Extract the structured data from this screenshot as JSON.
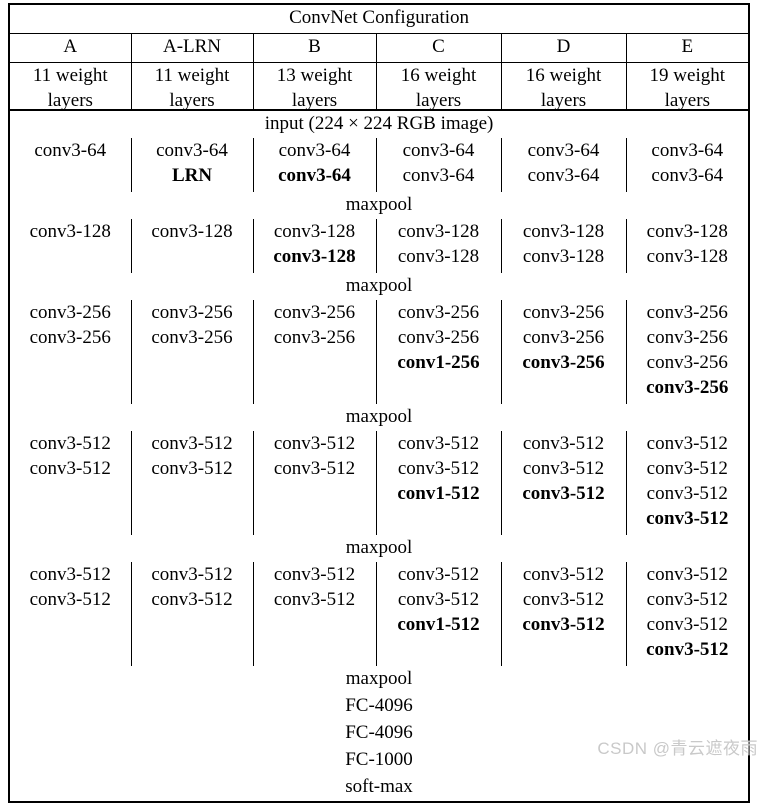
{
  "table": {
    "title": "ConvNet Configuration",
    "columns": [
      {
        "name": "A",
        "depth": "11 weight layers"
      },
      {
        "name": "A-LRN",
        "depth": "11 weight layers"
      },
      {
        "name": "B",
        "depth": "13 weight layers"
      },
      {
        "name": "C",
        "depth": "16 weight layers"
      },
      {
        "name": "D",
        "depth": "16 weight layers"
      },
      {
        "name": "E",
        "depth": "19 weight layers"
      }
    ],
    "input_row": "input (224 × 224 RGB image)",
    "pool_label": "maxpool",
    "blocks": [
      {
        "id": "block-64",
        "cells": [
          [
            {
              "text": "conv3-64",
              "bold": false
            }
          ],
          [
            {
              "text": "conv3-64",
              "bold": false
            },
            {
              "text": "LRN",
              "bold": true
            }
          ],
          [
            {
              "text": "conv3-64",
              "bold": false
            },
            {
              "text": "conv3-64",
              "bold": true
            }
          ],
          [
            {
              "text": "conv3-64",
              "bold": false
            },
            {
              "text": "conv3-64",
              "bold": false
            }
          ],
          [
            {
              "text": "conv3-64",
              "bold": false
            },
            {
              "text": "conv3-64",
              "bold": false
            }
          ],
          [
            {
              "text": "conv3-64",
              "bold": false
            },
            {
              "text": "conv3-64",
              "bold": false
            }
          ]
        ]
      },
      {
        "id": "block-128",
        "cells": [
          [
            {
              "text": "conv3-128",
              "bold": false
            }
          ],
          [
            {
              "text": "conv3-128",
              "bold": false
            }
          ],
          [
            {
              "text": "conv3-128",
              "bold": false
            },
            {
              "text": "conv3-128",
              "bold": true
            }
          ],
          [
            {
              "text": "conv3-128",
              "bold": false
            },
            {
              "text": "conv3-128",
              "bold": false
            }
          ],
          [
            {
              "text": "conv3-128",
              "bold": false
            },
            {
              "text": "conv3-128",
              "bold": false
            }
          ],
          [
            {
              "text": "conv3-128",
              "bold": false
            },
            {
              "text": "conv3-128",
              "bold": false
            }
          ]
        ]
      },
      {
        "id": "block-256",
        "cells": [
          [
            {
              "text": "conv3-256",
              "bold": false
            },
            {
              "text": "conv3-256",
              "bold": false
            }
          ],
          [
            {
              "text": "conv3-256",
              "bold": false
            },
            {
              "text": "conv3-256",
              "bold": false
            }
          ],
          [
            {
              "text": "conv3-256",
              "bold": false
            },
            {
              "text": "conv3-256",
              "bold": false
            }
          ],
          [
            {
              "text": "conv3-256",
              "bold": false
            },
            {
              "text": "conv3-256",
              "bold": false
            },
            {
              "text": "conv1-256",
              "bold": true
            }
          ],
          [
            {
              "text": "conv3-256",
              "bold": false
            },
            {
              "text": "conv3-256",
              "bold": false
            },
            {
              "text": "conv3-256",
              "bold": true
            }
          ],
          [
            {
              "text": "conv3-256",
              "bold": false
            },
            {
              "text": "conv3-256",
              "bold": false
            },
            {
              "text": "conv3-256",
              "bold": false
            },
            {
              "text": "conv3-256",
              "bold": true
            }
          ]
        ]
      },
      {
        "id": "block-512a",
        "cells": [
          [
            {
              "text": "conv3-512",
              "bold": false
            },
            {
              "text": "conv3-512",
              "bold": false
            }
          ],
          [
            {
              "text": "conv3-512",
              "bold": false
            },
            {
              "text": "conv3-512",
              "bold": false
            }
          ],
          [
            {
              "text": "conv3-512",
              "bold": false
            },
            {
              "text": "conv3-512",
              "bold": false
            }
          ],
          [
            {
              "text": "conv3-512",
              "bold": false
            },
            {
              "text": "conv3-512",
              "bold": false
            },
            {
              "text": "conv1-512",
              "bold": true
            }
          ],
          [
            {
              "text": "conv3-512",
              "bold": false
            },
            {
              "text": "conv3-512",
              "bold": false
            },
            {
              "text": "conv3-512",
              "bold": true
            }
          ],
          [
            {
              "text": "conv3-512",
              "bold": false
            },
            {
              "text": "conv3-512",
              "bold": false
            },
            {
              "text": "conv3-512",
              "bold": false
            },
            {
              "text": "conv3-512",
              "bold": true
            }
          ]
        ]
      },
      {
        "id": "block-512b",
        "cells": [
          [
            {
              "text": "conv3-512",
              "bold": false
            },
            {
              "text": "conv3-512",
              "bold": false
            }
          ],
          [
            {
              "text": "conv3-512",
              "bold": false
            },
            {
              "text": "conv3-512",
              "bold": false
            }
          ],
          [
            {
              "text": "conv3-512",
              "bold": false
            },
            {
              "text": "conv3-512",
              "bold": false
            }
          ],
          [
            {
              "text": "conv3-512",
              "bold": false
            },
            {
              "text": "conv3-512",
              "bold": false
            },
            {
              "text": "conv1-512",
              "bold": true
            }
          ],
          [
            {
              "text": "conv3-512",
              "bold": false
            },
            {
              "text": "conv3-512",
              "bold": false
            },
            {
              "text": "conv3-512",
              "bold": true
            }
          ],
          [
            {
              "text": "conv3-512",
              "bold": false
            },
            {
              "text": "conv3-512",
              "bold": false
            },
            {
              "text": "conv3-512",
              "bold": false
            },
            {
              "text": "conv3-512",
              "bold": true
            }
          ]
        ]
      }
    ],
    "tail_rows": [
      "maxpool",
      "FC-4096",
      "FC-4096",
      "FC-1000",
      "soft-max"
    ]
  },
  "watermark": {
    "text": "CSDN @青云遮夜雨",
    "color": "#c9c9c9"
  }
}
